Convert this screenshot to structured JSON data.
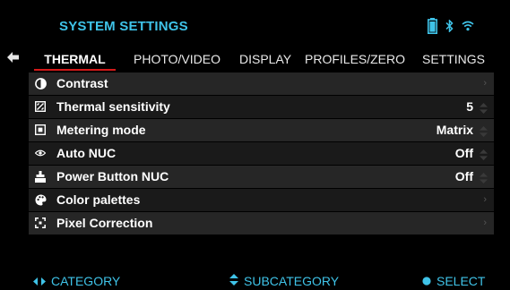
{
  "header": {
    "title": "SYSTEM SETTINGS",
    "status_icons": [
      "battery-icon",
      "bluetooth-icon",
      "wifi-icon"
    ]
  },
  "colors": {
    "accent": "#3fc3e8",
    "active_tab_underline": "#d41a1a",
    "row_bg": "#262626",
    "row_alt_bg": "#1a1a1a"
  },
  "tabs": [
    {
      "label": "THERMAL",
      "active": true
    },
    {
      "label": "PHOTO/VIDEO",
      "active": false
    },
    {
      "label": "DISPLAY",
      "active": false
    },
    {
      "label": "PROFILES/ZERO",
      "active": false
    },
    {
      "label": "SETTINGS",
      "active": false
    }
  ],
  "rows": [
    {
      "label": "Contrast",
      "icon": "contrast-icon",
      "value": "",
      "control": "chevron"
    },
    {
      "label": "Thermal sensitivity",
      "icon": "sensitivity-icon",
      "value": "5",
      "control": "spinner"
    },
    {
      "label": "Metering mode",
      "icon": "metering-icon",
      "value": "Matrix",
      "control": "spinner"
    },
    {
      "label": "Auto NUC",
      "icon": "eye-icon",
      "value": "Off",
      "control": "spinner"
    },
    {
      "label": "Power Button NUC",
      "icon": "power-button-icon",
      "value": "Off",
      "control": "spinner"
    },
    {
      "label": "Color palettes",
      "icon": "palette-icon",
      "value": "",
      "control": "chevron"
    },
    {
      "label": "Pixel Correction",
      "icon": "pixel-correction-icon",
      "value": "",
      "control": "chevron"
    }
  ],
  "footer": {
    "category": "CATEGORY",
    "subcategory": "SUBCATEGORY",
    "select": "SELECT"
  }
}
